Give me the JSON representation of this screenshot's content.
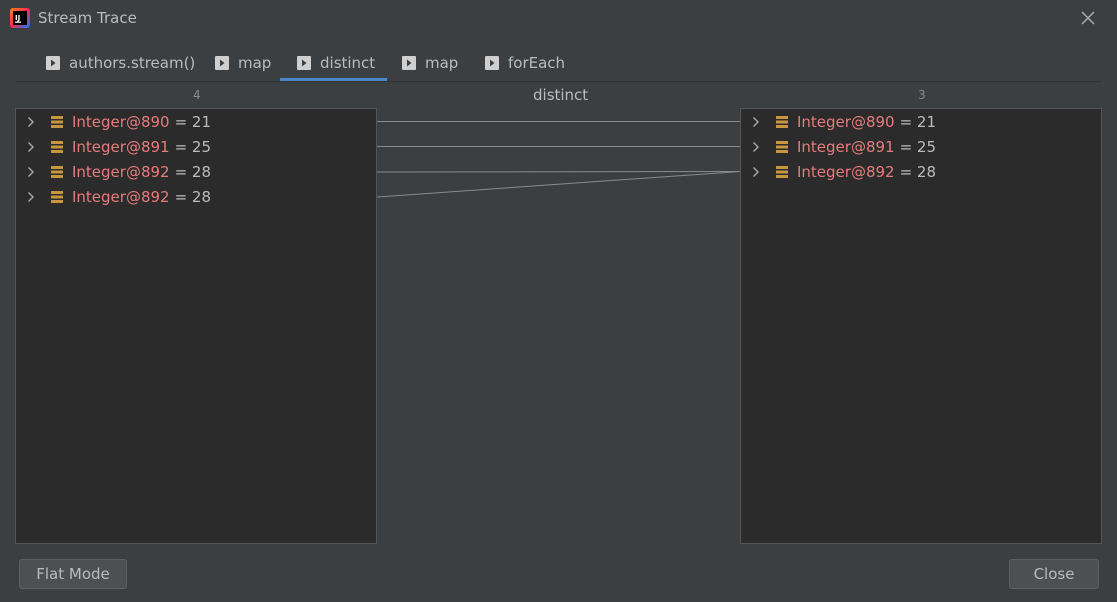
{
  "window": {
    "title": "Stream Trace"
  },
  "tabs": [
    {
      "label": "authors.stream()",
      "active": false
    },
    {
      "label": "map",
      "active": false
    },
    {
      "label": "distinct",
      "active": true
    },
    {
      "label": "map",
      "active": false
    },
    {
      "label": "forEach",
      "active": false
    }
  ],
  "before": {
    "count": "4",
    "items": [
      {
        "name": "Integer@890",
        "value": "= 21"
      },
      {
        "name": "Integer@891",
        "value": "= 25"
      },
      {
        "name": "Integer@892",
        "value": "= 28"
      },
      {
        "name": "Integer@892",
        "value": "= 28"
      }
    ]
  },
  "operation": {
    "name": "distinct"
  },
  "after": {
    "count": "3",
    "items": [
      {
        "name": "Integer@890",
        "value": "= 21"
      },
      {
        "name": "Integer@891",
        "value": "= 25"
      },
      {
        "name": "Integer@892",
        "value": "= 28"
      }
    ]
  },
  "mapping": [
    [
      0,
      0
    ],
    [
      1,
      1
    ],
    [
      2,
      2
    ],
    [
      3,
      2
    ]
  ],
  "buttons": {
    "flat_mode": "Flat Mode",
    "close": "Close"
  },
  "colors": {
    "accent": "#4a88c7",
    "object_name": "#e77b7b",
    "object_icon": "#c8963e"
  }
}
